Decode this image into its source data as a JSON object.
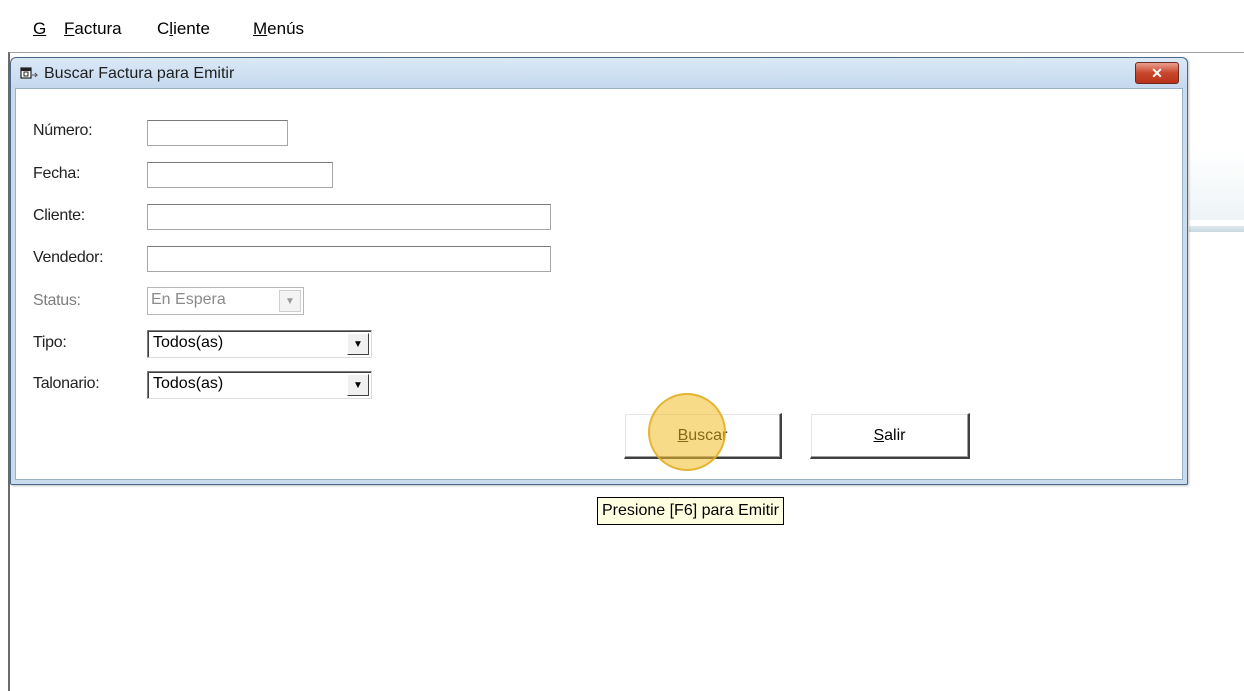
{
  "menubar": {
    "items": [
      {
        "mnemonic": "G",
        "rest": ""
      },
      {
        "mnemonic": "F",
        "rest": "actura"
      },
      {
        "prefix": "C",
        "mnemonic": "l",
        "rest": "iente"
      },
      {
        "mnemonic": "M",
        "rest": "enús"
      }
    ]
  },
  "dialog": {
    "title": "Buscar Factura para Emitir",
    "close_glyph": "✕"
  },
  "form": {
    "numero_label": "Número:",
    "fecha_label": "Fecha:",
    "cliente_label": "Cliente:",
    "vendedor_label": "Vendedor:",
    "status_label": "Status:",
    "status_value": "En Espera",
    "tipo_label": "Tipo:",
    "tipo_value": "Todos(as)",
    "talonario_label": "Talonario:",
    "talonario_value": "Todos(as)",
    "numero_value": "",
    "fecha_value": "",
    "cliente_value": "",
    "vendedor_value": ""
  },
  "buttons": {
    "buscar_mnemonic": "B",
    "buscar_rest": "uscar",
    "salir_mnemonic": "S",
    "salir_rest": "alir"
  },
  "tooltip": "Presione [F6] para Emitir",
  "icons": {
    "dropdown_arrow": "▼",
    "window_icon": "form-window-icon"
  }
}
